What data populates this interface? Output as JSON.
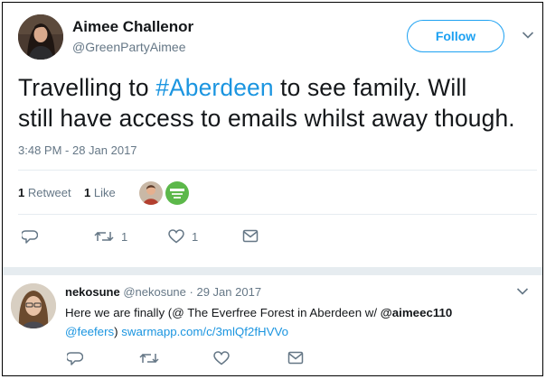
{
  "tweet": {
    "author_name": "Aimee Challenor",
    "author_handle": "@GreenPartyAimee",
    "follow_label": "Follow",
    "text_part1": "Travelling to ",
    "hashtag": "#Aberdeen",
    "text_part2": " to see family. Will",
    "text_line2": "still have access to emails whilst away though.",
    "timestamp": "3:48 PM - 28 Jan 2017",
    "retweets_count": "1",
    "retweets_label": "Retweet",
    "likes_count": "1",
    "likes_label": "Like",
    "actions": {
      "retweet_count": "1",
      "like_count": "1"
    }
  },
  "reply": {
    "author_name": "nekosune",
    "author_handle": "@nekosune",
    "separator": "·",
    "date": "29 Jan 2017",
    "text_part1": "Here we are finally (@ The Everfree Forest in Aberdeen w/ ",
    "mention1": "@aimeec110",
    "mention2": "@feefers",
    "text_part2": ") ",
    "url": "swarmapp.com/c/3mlQf2fHVVo"
  },
  "colors": {
    "accent": "#1da1f2",
    "link": "#1b95e0",
    "muted": "#657786",
    "divider": "#e6ecf0"
  },
  "icons": [
    "chevron-down-icon",
    "reply-icon",
    "retweet-icon",
    "like-icon",
    "message-icon"
  ]
}
